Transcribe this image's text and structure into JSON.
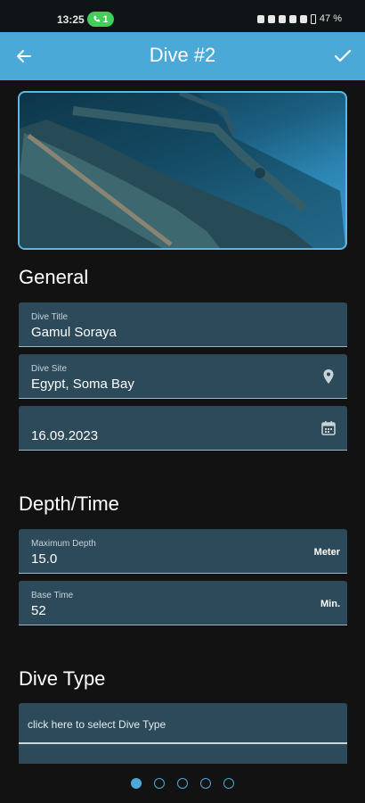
{
  "status_bar": {
    "time": "13:25",
    "badge": "1",
    "battery": "47 %"
  },
  "app_bar": {
    "title": "Dive #2",
    "back_icon": "arrow-left-icon",
    "confirm_icon": "check-icon"
  },
  "hero_image": {
    "icon": "underwater-wreck-photo"
  },
  "general": {
    "heading": "General",
    "dive_title": {
      "label": "Dive Title",
      "value": "Gamul Soraya"
    },
    "dive_site": {
      "label": "Dive Site",
      "value": "Egypt, Soma Bay",
      "icon": "location-pin-icon"
    },
    "date": {
      "value": "16.09.2023",
      "icon": "calendar-icon"
    }
  },
  "depth_time": {
    "heading": "Depth/Time",
    "max_depth": {
      "label": "Maximum Depth",
      "value": "15.0",
      "unit": "Meter"
    },
    "base_time": {
      "label": "Base Time",
      "value": "52",
      "unit": "Min."
    }
  },
  "dive_type": {
    "heading": "Dive Type",
    "placeholder": "click here to select Dive Type"
  },
  "pager": {
    "pages": 5,
    "active_index": 0
  },
  "colors": {
    "accent": "#4ba9d8",
    "field_bg": "#2c4a5a",
    "background": "#121212"
  }
}
